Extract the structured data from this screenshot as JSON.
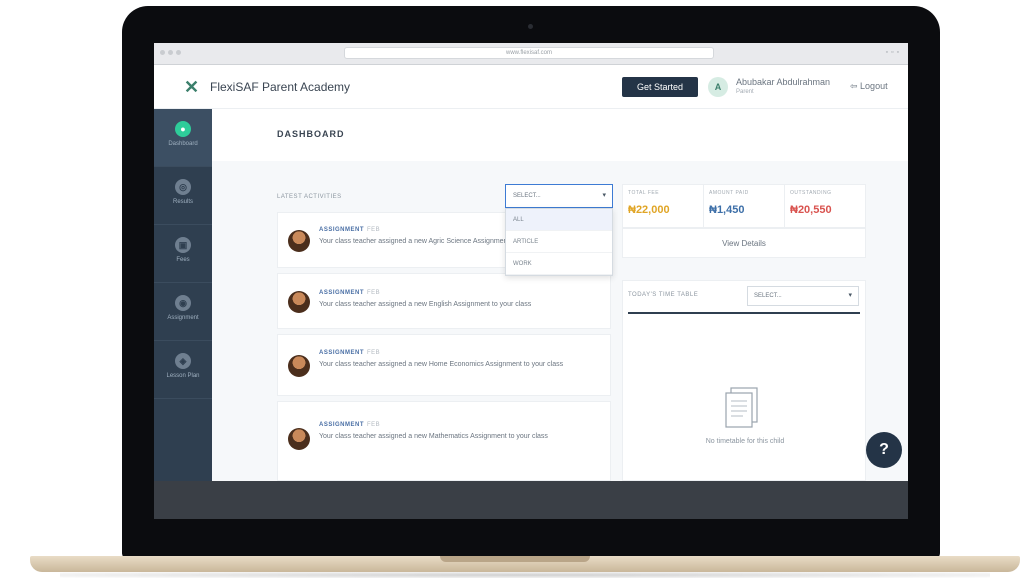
{
  "browser": {
    "address": "www.flexisaf.com"
  },
  "header": {
    "app_title": "FlexiSAF Parent Academy",
    "logo_icon": "flexisaf-x-logo",
    "get_started_label": "Get Started",
    "avatar_initial": "A",
    "user_name": "Abubakar Abdulrahman",
    "user_role": "Parent",
    "logout_label": "Logout"
  },
  "sidebar": {
    "items": [
      {
        "label": "Dashboard",
        "icon": "dashboard-icon",
        "glyph": "●",
        "active": true
      },
      {
        "label": "Results",
        "icon": "results-icon",
        "glyph": "◎",
        "active": false
      },
      {
        "label": "Fees",
        "icon": "fees-icon",
        "glyph": "▣",
        "active": false
      },
      {
        "label": "Assignment",
        "icon": "assignment-icon",
        "glyph": "◉",
        "active": false
      },
      {
        "label": "Lesson Plan",
        "icon": "lesson-plan-icon",
        "glyph": "◈",
        "active": false
      }
    ]
  },
  "main": {
    "page_title": "DASHBOARD",
    "latest_activities_label": "LATEST ACTIVITIES",
    "activity_select": {
      "value": "SELECT...",
      "options": [
        "ALL",
        "ARTICLE",
        "WORK"
      ]
    },
    "activities": [
      {
        "type": "ASSIGNMENT",
        "ago": "FEB",
        "text": "Your class teacher assigned a new Agric Science Assignment to your class"
      },
      {
        "type": "ASSIGNMENT",
        "ago": "FEB",
        "text": "Your class teacher assigned a new English Assignment to your class"
      },
      {
        "type": "ASSIGNMENT",
        "ago": "FEB",
        "text": "Your class teacher assigned a new Home Economics Assignment to your class"
      },
      {
        "type": "ASSIGNMENT",
        "ago": "FEB",
        "text": "Your class teacher assigned a new Mathematics Assignment to your class"
      }
    ]
  },
  "fees": {
    "stats": [
      {
        "label": "TOTAL FEE",
        "value": "₦22,000",
        "color": "#e0a526"
      },
      {
        "label": "AMOUNT PAID",
        "value": "₦1,450",
        "color": "#3d6fa8"
      },
      {
        "label": "OUTSTANDING",
        "value": "₦20,550",
        "color": "#d9534f"
      }
    ],
    "view_details_label": "View Details"
  },
  "timetable": {
    "label": "TODAY'S TIME TABLE",
    "select_value": "SELECT...",
    "empty_message": "No timetable for this child",
    "empty_icon": "document-icon"
  },
  "help": {
    "glyph": "?",
    "icon": "help-icon"
  },
  "colors": {
    "sidebar": "#2f3f50",
    "accent": "#2ecc9a",
    "primary_button": "#243447"
  }
}
